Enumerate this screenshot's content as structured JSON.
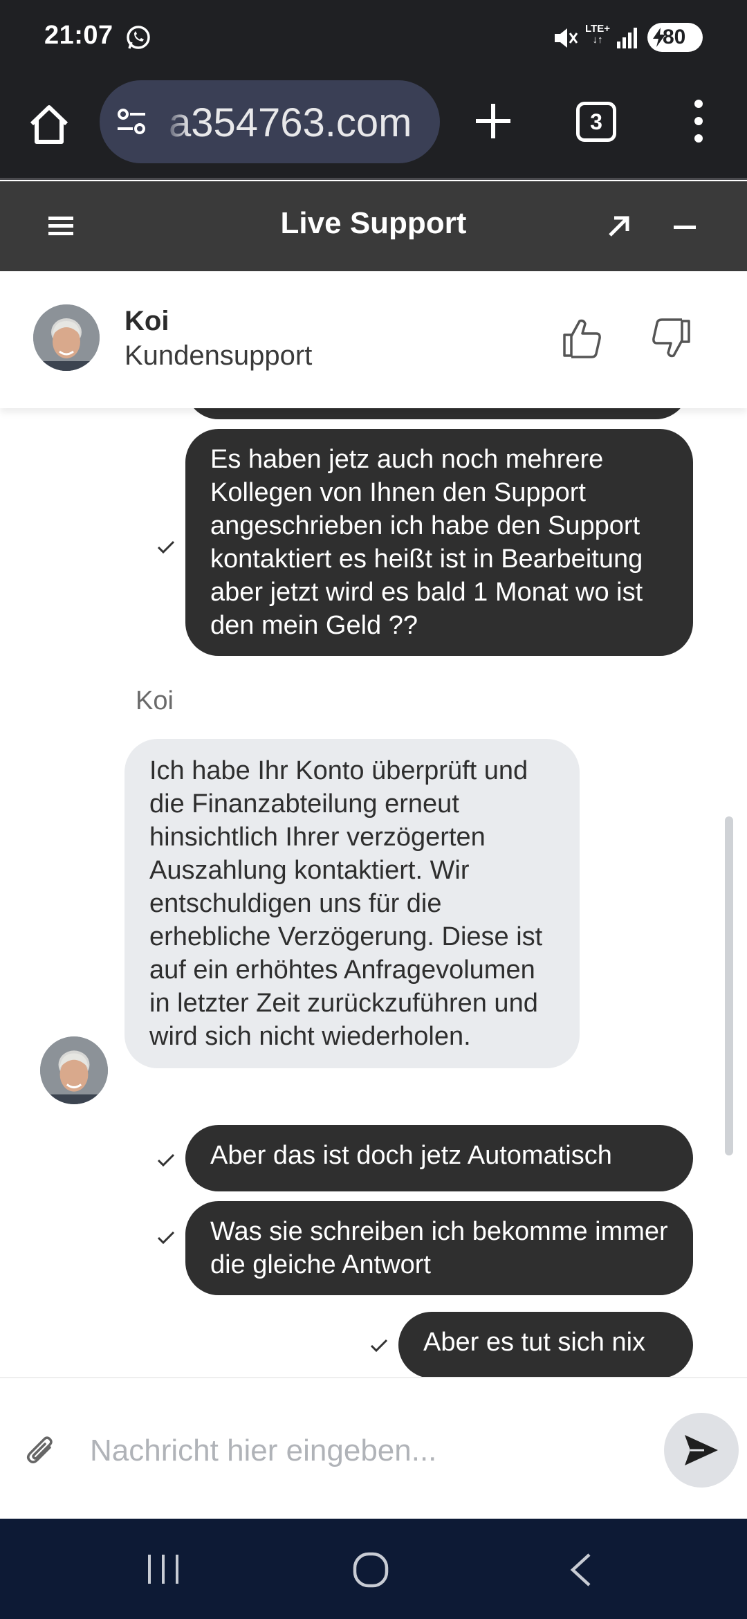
{
  "status_bar": {
    "time": "21:07",
    "network": "LTE+",
    "battery": "80",
    "icons": [
      "whatsapp-icon",
      "mute-icon",
      "signal-icon",
      "battery-icon"
    ]
  },
  "browser": {
    "url": "a354763.com",
    "tab_count": "3"
  },
  "support_header": {
    "title": "Live Support"
  },
  "agent": {
    "name": "Koi",
    "role": "Kundensupport"
  },
  "chat": {
    "messages": [
      {
        "from": "user",
        "text": "Es haben jetz auch noch mehrere Kollegen von Ihnen den Support angeschrieben ich habe den Support kontaktiert es heißt ist in Bearbeitung aber jetzt wird es bald 1 Monat wo ist den mein Geld ??"
      },
      {
        "from": "agent",
        "sender": "Koi",
        "text": "Ich habe Ihr Konto überprüft und die Finanzabteilung erneut hinsichtlich Ihrer verzögerten Auszahlung kontaktiert. Wir entschuldigen uns für die erhebliche Verzögerung. Diese ist auf ein erhöhtes Anfragevolumen in letzter Zeit zurückzuführen und wird sich nicht wiederholen."
      },
      {
        "from": "user",
        "text": "Aber das ist doch jetz Automatisch"
      },
      {
        "from": "user",
        "text": "Was sie schreiben ich bekomme immer die gleiche Antwort"
      },
      {
        "from": "user",
        "text": "Aber es tut sich nix"
      }
    ]
  },
  "composer": {
    "placeholder": "Nachricht hier eingeben..."
  },
  "colors": {
    "status_bar_bg": "#1f2023",
    "header_bg": "#3a3a3a",
    "user_bubble": "#2f2f2f",
    "agent_bubble": "#e9ebee",
    "nav_bar_bg": "#0d1a35"
  }
}
